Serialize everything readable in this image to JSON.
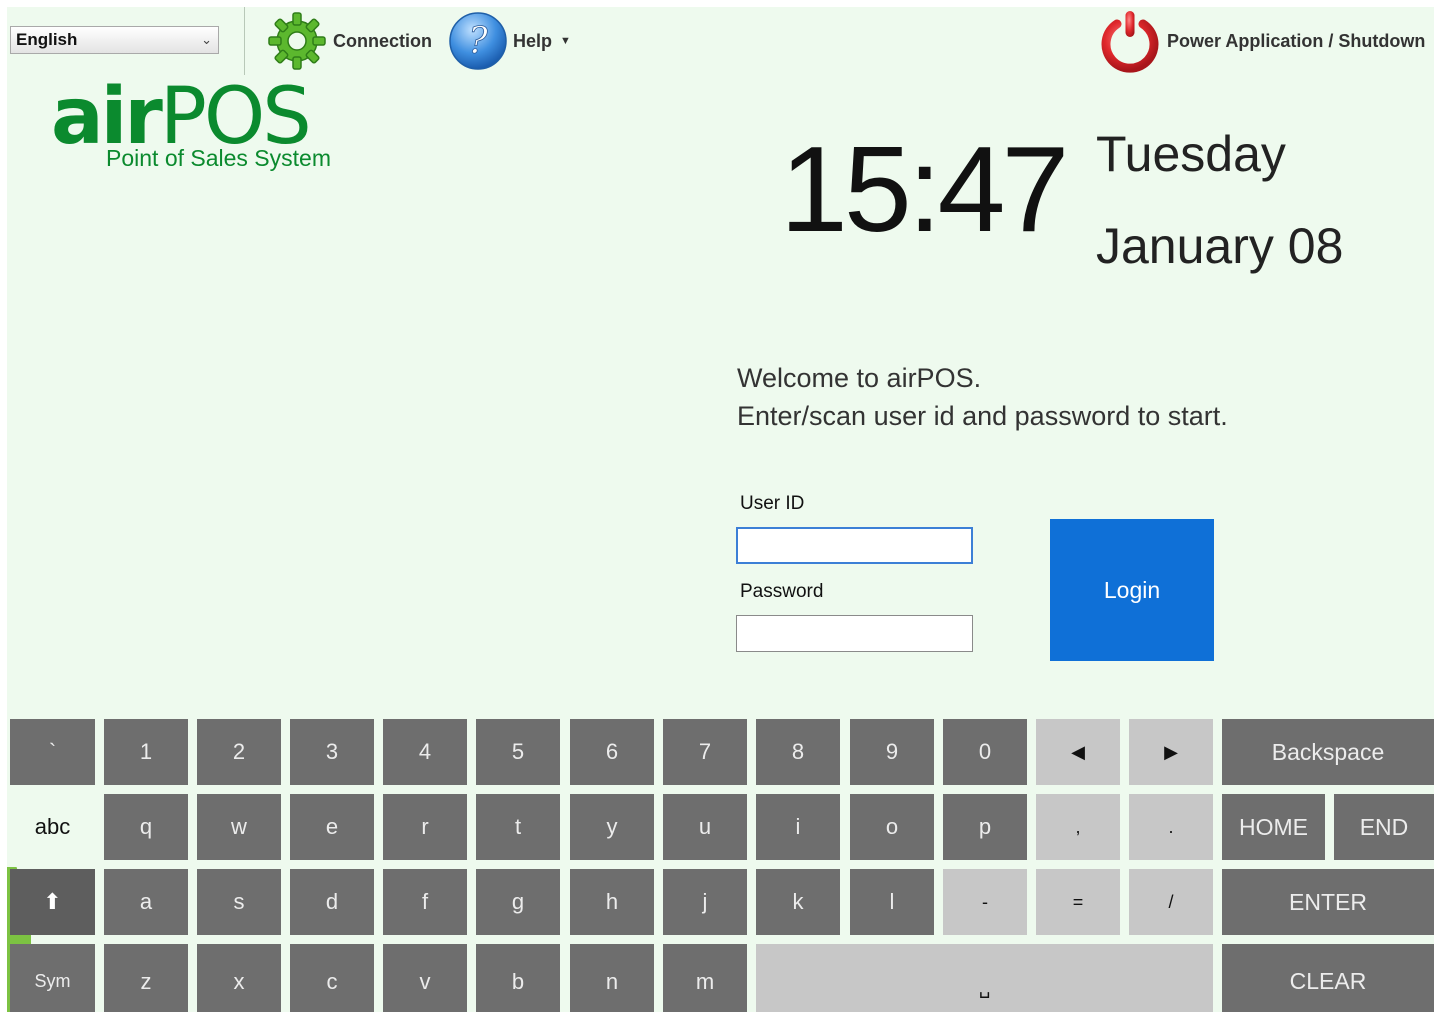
{
  "colors": {
    "background": "#eefaee",
    "brand_green": "#0b8a2e",
    "login_blue": "#0f70d7",
    "key_dark": "#6e6e6e",
    "key_light": "#c7c7c7"
  },
  "toolbar": {
    "language": {
      "selected": "English"
    },
    "connection_label": "Connection",
    "help_label": "Help",
    "power_label": "Power Application / Shutdown",
    "icons": {
      "connection": "gear-icon",
      "help": "question-icon",
      "power": "power-icon"
    }
  },
  "logo": {
    "word": "airPOS",
    "word_bold": "air",
    "word_rest": "POS",
    "subtitle": "Point of Sales System"
  },
  "clock": {
    "time": "15:47",
    "day": "Tuesday",
    "date": "January 08"
  },
  "welcome": {
    "line1": "Welcome to airPOS.",
    "line2": "Enter/scan user id and password to start."
  },
  "form": {
    "userid_label": "User ID",
    "userid_value": "",
    "password_label": "Password",
    "password_value": "",
    "login_label": "Login"
  },
  "keyboard": {
    "rows": [
      [
        "`",
        "1",
        "2",
        "3",
        "4",
        "5",
        "6",
        "7",
        "8",
        "9",
        "0",
        "◀",
        "▶",
        "Backspace"
      ],
      [
        "abc",
        "q",
        "w",
        "e",
        "r",
        "t",
        "y",
        "u",
        "i",
        "o",
        "p",
        ",",
        ".",
        "HOME",
        "END"
      ],
      [
        "⬆",
        "a",
        "s",
        "d",
        "f",
        "g",
        "h",
        "j",
        "k",
        "l",
        "-",
        "=",
        "/",
        "ENTER"
      ],
      [
        "Sym",
        "z",
        "x",
        "c",
        "v",
        "b",
        "n",
        "m",
        "␣",
        "CLEAR"
      ]
    ]
  }
}
